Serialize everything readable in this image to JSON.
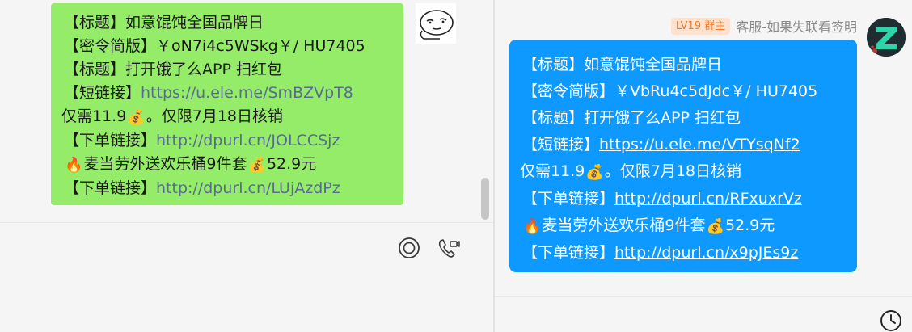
{
  "left_message": {
    "line1": "【标题】如意馄饨全国品牌日",
    "line2": "【密令简版】￥oN7i4c5WSkg￥/ HU7405",
    "line3": "【标题】打开饿了么APP 扫红包",
    "line4_label": "【短链接】",
    "line4_link": "https://u.ele.me/SmBZVpT8",
    "line5_a": "仅需11.9",
    "line5_b": "。仅限7月18日核销",
    "line6_label": "【下单链接】",
    "line6_link": "http://dpurl.cn/JOLCCSjz",
    "line7_a": "麦当劳外送欢乐桶9件套",
    "line7_b": "52.9元",
    "line8_label": "【下单链接】",
    "line8_link": "http://dpurl.cn/LUjAzdPz"
  },
  "right_sender": {
    "level_badge": "LV19 群主",
    "name": "客服-如果失联看签明"
  },
  "right_message": {
    "line1": "【标题】如意馄饨全国品牌日",
    "line2": "【密令简版】￥VbRu4c5dJdc￥/ HU7405",
    "line3": "【标题】打开饿了么APP 扫红包",
    "line4_label": "【短链接】",
    "line4_link": "https://u.ele.me/VTYsqNf2",
    "line5_a": "仅需11.9",
    "line5_b": "。仅限7月18日核销",
    "line6_label": "【下单链接】",
    "line6_link": "http://dpurl.cn/RFxuxrVz",
    "line7_a": "麦当劳外送欢乐桶9件套",
    "line7_b": "52.9元",
    "line8_label": "【下单链接】",
    "line8_link": "http://dpurl.cn/x9pJEs9z"
  },
  "emojis": {
    "money_bag": "💰",
    "fire": "🔥"
  },
  "icons": {
    "target": "target-icon",
    "video_call": "video-call-icon",
    "clock": "clock-icon",
    "money_bag": "money-bag-icon",
    "fire": "fire-icon"
  },
  "colors": {
    "left_bubble": "#95ec69",
    "right_bubble": "#0d99ff",
    "link_left": "#576b95",
    "badge_bg": "#fde3cf",
    "badge_text": "#f07b2a",
    "avatar_accent": "#2fd3a8"
  }
}
